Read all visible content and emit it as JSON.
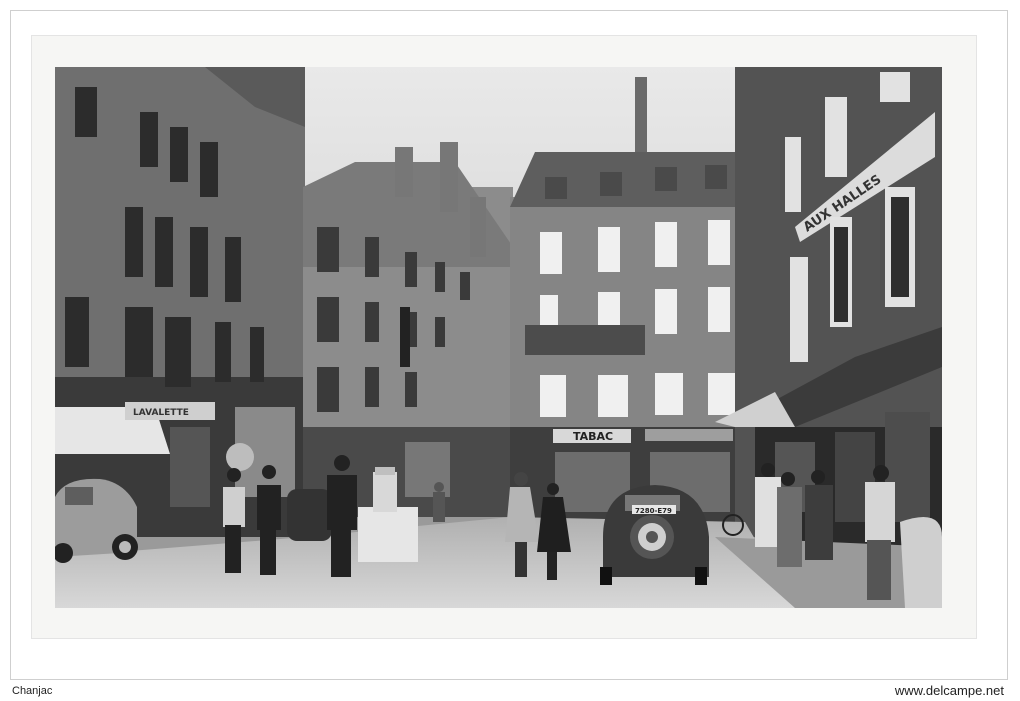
{
  "photo": {
    "signs": {
      "tabac": "TABAC",
      "halles": "AUX HALLES",
      "left_shop": "LAVALETTE",
      "plate": "7280-E79"
    }
  },
  "footer": {
    "left": "Chanjac",
    "right": "www.delcampe.net"
  }
}
